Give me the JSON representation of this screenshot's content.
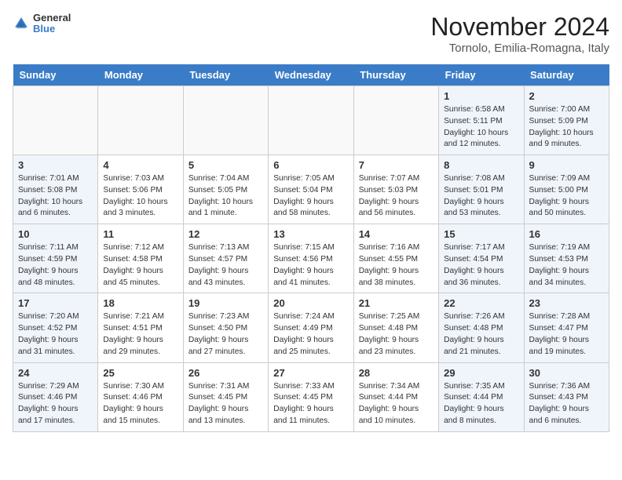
{
  "header": {
    "logo_line1": "General",
    "logo_line2": "Blue",
    "month_title": "November 2024",
    "location": "Tornolo, Emilia-Romagna, Italy"
  },
  "days_of_week": [
    "Sunday",
    "Monday",
    "Tuesday",
    "Wednesday",
    "Thursday",
    "Friday",
    "Saturday"
  ],
  "weeks": [
    [
      {
        "day": "",
        "sunrise": "",
        "sunset": "",
        "daylight": "",
        "type": "empty"
      },
      {
        "day": "",
        "sunrise": "",
        "sunset": "",
        "daylight": "",
        "type": "empty"
      },
      {
        "day": "",
        "sunrise": "",
        "sunset": "",
        "daylight": "",
        "type": "empty"
      },
      {
        "day": "",
        "sunrise": "",
        "sunset": "",
        "daylight": "",
        "type": "empty"
      },
      {
        "day": "",
        "sunrise": "",
        "sunset": "",
        "daylight": "",
        "type": "empty"
      },
      {
        "day": "1",
        "sunrise": "Sunrise: 6:58 AM",
        "sunset": "Sunset: 5:11 PM",
        "daylight": "Daylight: 10 hours and 12 minutes.",
        "type": "weekend"
      },
      {
        "day": "2",
        "sunrise": "Sunrise: 7:00 AM",
        "sunset": "Sunset: 5:09 PM",
        "daylight": "Daylight: 10 hours and 9 minutes.",
        "type": "weekend"
      }
    ],
    [
      {
        "day": "3",
        "sunrise": "Sunrise: 7:01 AM",
        "sunset": "Sunset: 5:08 PM",
        "daylight": "Daylight: 10 hours and 6 minutes.",
        "type": "weekend"
      },
      {
        "day": "4",
        "sunrise": "Sunrise: 7:03 AM",
        "sunset": "Sunset: 5:06 PM",
        "daylight": "Daylight: 10 hours and 3 minutes.",
        "type": "weekday"
      },
      {
        "day": "5",
        "sunrise": "Sunrise: 7:04 AM",
        "sunset": "Sunset: 5:05 PM",
        "daylight": "Daylight: 10 hours and 1 minute.",
        "type": "weekday"
      },
      {
        "day": "6",
        "sunrise": "Sunrise: 7:05 AM",
        "sunset": "Sunset: 5:04 PM",
        "daylight": "Daylight: 9 hours and 58 minutes.",
        "type": "weekday"
      },
      {
        "day": "7",
        "sunrise": "Sunrise: 7:07 AM",
        "sunset": "Sunset: 5:03 PM",
        "daylight": "Daylight: 9 hours and 56 minutes.",
        "type": "weekday"
      },
      {
        "day": "8",
        "sunrise": "Sunrise: 7:08 AM",
        "sunset": "Sunset: 5:01 PM",
        "daylight": "Daylight: 9 hours and 53 minutes.",
        "type": "weekend"
      },
      {
        "day": "9",
        "sunrise": "Sunrise: 7:09 AM",
        "sunset": "Sunset: 5:00 PM",
        "daylight": "Daylight: 9 hours and 50 minutes.",
        "type": "weekend"
      }
    ],
    [
      {
        "day": "10",
        "sunrise": "Sunrise: 7:11 AM",
        "sunset": "Sunset: 4:59 PM",
        "daylight": "Daylight: 9 hours and 48 minutes.",
        "type": "weekend"
      },
      {
        "day": "11",
        "sunrise": "Sunrise: 7:12 AM",
        "sunset": "Sunset: 4:58 PM",
        "daylight": "Daylight: 9 hours and 45 minutes.",
        "type": "weekday"
      },
      {
        "day": "12",
        "sunrise": "Sunrise: 7:13 AM",
        "sunset": "Sunset: 4:57 PM",
        "daylight": "Daylight: 9 hours and 43 minutes.",
        "type": "weekday"
      },
      {
        "day": "13",
        "sunrise": "Sunrise: 7:15 AM",
        "sunset": "Sunset: 4:56 PM",
        "daylight": "Daylight: 9 hours and 41 minutes.",
        "type": "weekday"
      },
      {
        "day": "14",
        "sunrise": "Sunrise: 7:16 AM",
        "sunset": "Sunset: 4:55 PM",
        "daylight": "Daylight: 9 hours and 38 minutes.",
        "type": "weekday"
      },
      {
        "day": "15",
        "sunrise": "Sunrise: 7:17 AM",
        "sunset": "Sunset: 4:54 PM",
        "daylight": "Daylight: 9 hours and 36 minutes.",
        "type": "weekend"
      },
      {
        "day": "16",
        "sunrise": "Sunrise: 7:19 AM",
        "sunset": "Sunset: 4:53 PM",
        "daylight": "Daylight: 9 hours and 34 minutes.",
        "type": "weekend"
      }
    ],
    [
      {
        "day": "17",
        "sunrise": "Sunrise: 7:20 AM",
        "sunset": "Sunset: 4:52 PM",
        "daylight": "Daylight: 9 hours and 31 minutes.",
        "type": "weekend"
      },
      {
        "day": "18",
        "sunrise": "Sunrise: 7:21 AM",
        "sunset": "Sunset: 4:51 PM",
        "daylight": "Daylight: 9 hours and 29 minutes.",
        "type": "weekday"
      },
      {
        "day": "19",
        "sunrise": "Sunrise: 7:23 AM",
        "sunset": "Sunset: 4:50 PM",
        "daylight": "Daylight: 9 hours and 27 minutes.",
        "type": "weekday"
      },
      {
        "day": "20",
        "sunrise": "Sunrise: 7:24 AM",
        "sunset": "Sunset: 4:49 PM",
        "daylight": "Daylight: 9 hours and 25 minutes.",
        "type": "weekday"
      },
      {
        "day": "21",
        "sunrise": "Sunrise: 7:25 AM",
        "sunset": "Sunset: 4:48 PM",
        "daylight": "Daylight: 9 hours and 23 minutes.",
        "type": "weekday"
      },
      {
        "day": "22",
        "sunrise": "Sunrise: 7:26 AM",
        "sunset": "Sunset: 4:48 PM",
        "daylight": "Daylight: 9 hours and 21 minutes.",
        "type": "weekend"
      },
      {
        "day": "23",
        "sunrise": "Sunrise: 7:28 AM",
        "sunset": "Sunset: 4:47 PM",
        "daylight": "Daylight: 9 hours and 19 minutes.",
        "type": "weekend"
      }
    ],
    [
      {
        "day": "24",
        "sunrise": "Sunrise: 7:29 AM",
        "sunset": "Sunset: 4:46 PM",
        "daylight": "Daylight: 9 hours and 17 minutes.",
        "type": "weekend"
      },
      {
        "day": "25",
        "sunrise": "Sunrise: 7:30 AM",
        "sunset": "Sunset: 4:46 PM",
        "daylight": "Daylight: 9 hours and 15 minutes.",
        "type": "weekday"
      },
      {
        "day": "26",
        "sunrise": "Sunrise: 7:31 AM",
        "sunset": "Sunset: 4:45 PM",
        "daylight": "Daylight: 9 hours and 13 minutes.",
        "type": "weekday"
      },
      {
        "day": "27",
        "sunrise": "Sunrise: 7:33 AM",
        "sunset": "Sunset: 4:45 PM",
        "daylight": "Daylight: 9 hours and 11 minutes.",
        "type": "weekday"
      },
      {
        "day": "28",
        "sunrise": "Sunrise: 7:34 AM",
        "sunset": "Sunset: 4:44 PM",
        "daylight": "Daylight: 9 hours and 10 minutes.",
        "type": "weekday"
      },
      {
        "day": "29",
        "sunrise": "Sunrise: 7:35 AM",
        "sunset": "Sunset: 4:44 PM",
        "daylight": "Daylight: 9 hours and 8 minutes.",
        "type": "weekend"
      },
      {
        "day": "30",
        "sunrise": "Sunrise: 7:36 AM",
        "sunset": "Sunset: 4:43 PM",
        "daylight": "Daylight: 9 hours and 6 minutes.",
        "type": "weekend"
      }
    ]
  ]
}
